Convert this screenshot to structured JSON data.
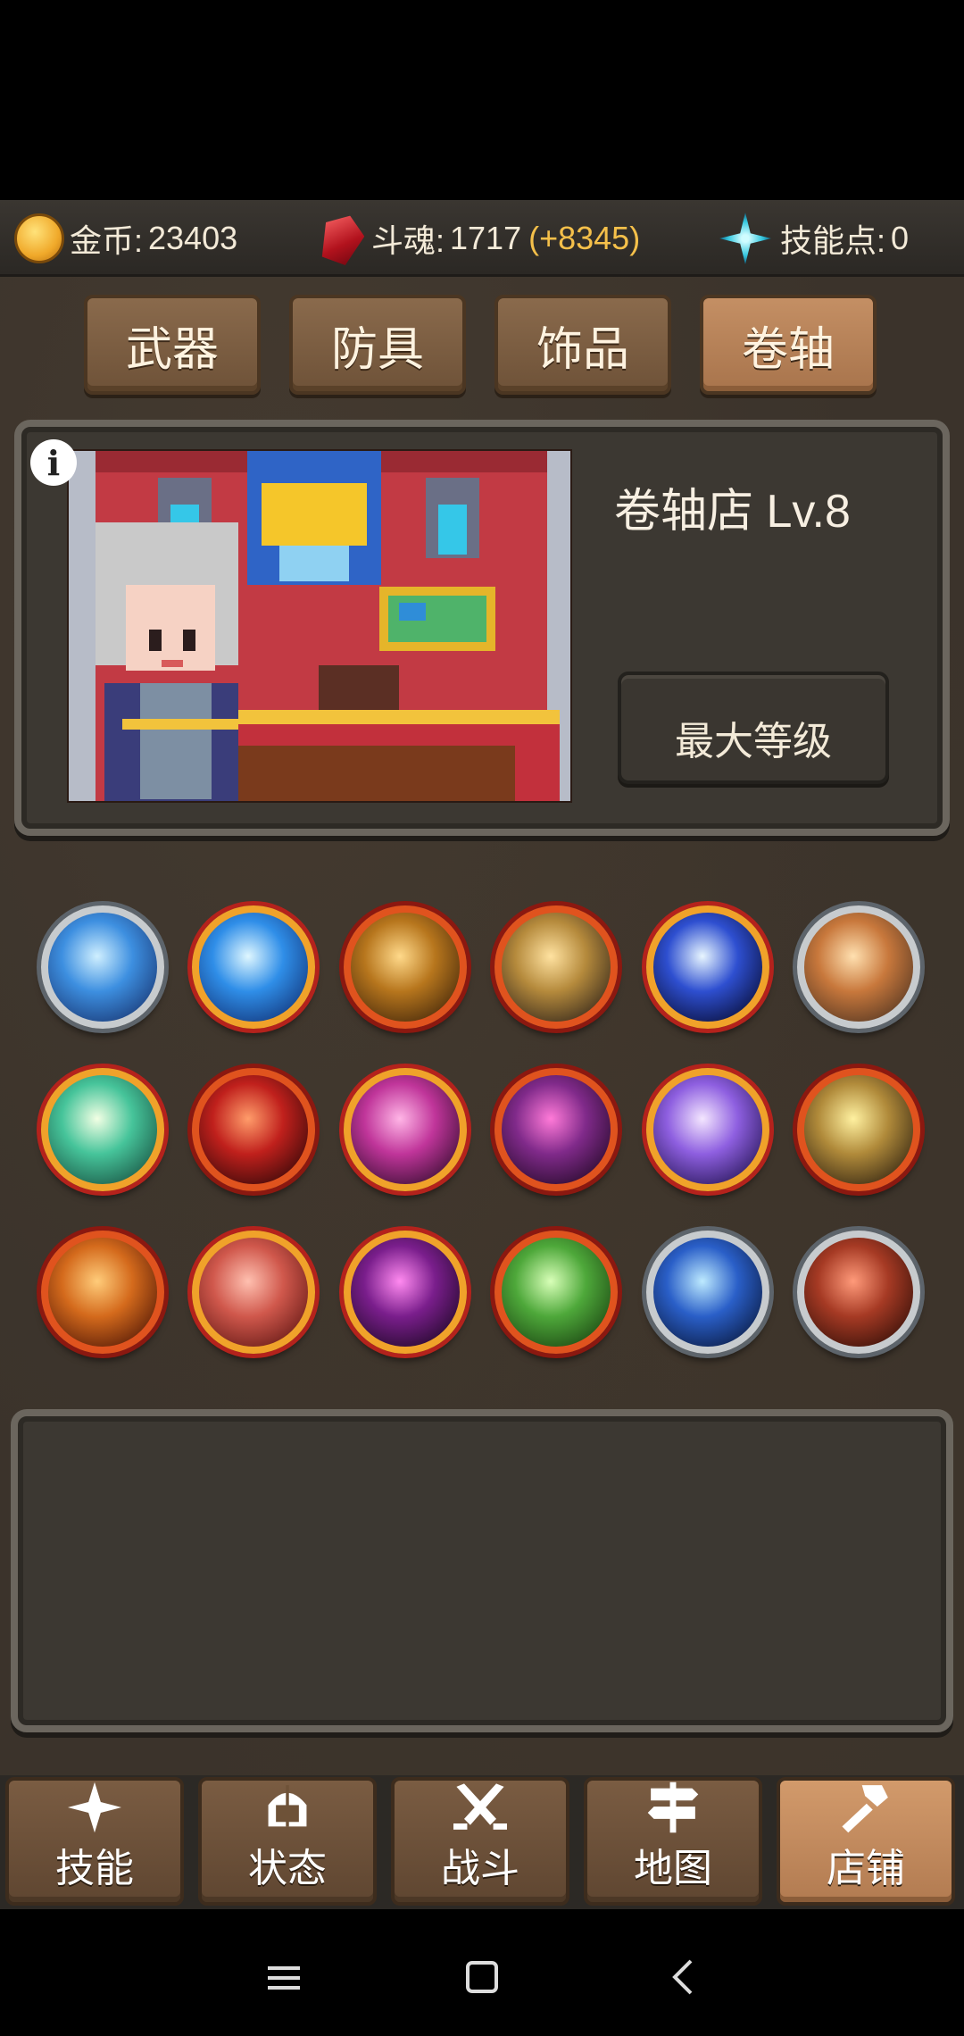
{
  "resources": {
    "gold_label": "金币:",
    "gold_value": "23403",
    "soul_label": "斗魂:",
    "soul_value": "1717",
    "soul_bonus": "(+8345)",
    "skill_label": "技能点:",
    "skill_value": "0"
  },
  "shop_tabs": [
    "武器",
    "防具",
    "饰品",
    "卷轴"
  ],
  "active_shop_tab": "卷轴",
  "shop": {
    "title": "卷轴店 Lv.8",
    "info_icon": "i",
    "max_level_label": "最大等级"
  },
  "scrolls": [
    {
      "icon": "ice-crystal-icon",
      "rim": "silver"
    },
    {
      "icon": "ice-shard-icon",
      "rim": "gold"
    },
    {
      "icon": "gold-rune-icon",
      "rim": "red"
    },
    {
      "icon": "golden-wing-icon",
      "rim": "red"
    },
    {
      "icon": "lightning-strike-icon",
      "rim": "gold"
    },
    {
      "icon": "fire-dash-icon",
      "rim": "silver"
    },
    {
      "icon": "green-swirl-icon",
      "rim": "gold"
    },
    {
      "icon": "red-crack-icon",
      "rim": "red"
    },
    {
      "icon": "pink-flame-icon",
      "rim": "gold"
    },
    {
      "icon": "demon-mask-icon",
      "rim": "red"
    },
    {
      "icon": "purple-burst-icon",
      "rim": "gold"
    },
    {
      "icon": "rock-fist-icon",
      "rim": "red"
    },
    {
      "icon": "amber-shard-icon",
      "rim": "red"
    },
    {
      "icon": "red-spiral-icon",
      "rim": "gold"
    },
    {
      "icon": "purple-net-icon",
      "rim": "gold"
    },
    {
      "icon": "heal-heart-icon",
      "rim": "red"
    },
    {
      "icon": "mystery-storm-icon",
      "rim": "silver"
    },
    {
      "icon": "beast-head-icon",
      "rim": "silver"
    }
  ],
  "nav": [
    "技能",
    "状态",
    "战斗",
    "地图",
    "店铺"
  ],
  "active_nav": "店铺"
}
